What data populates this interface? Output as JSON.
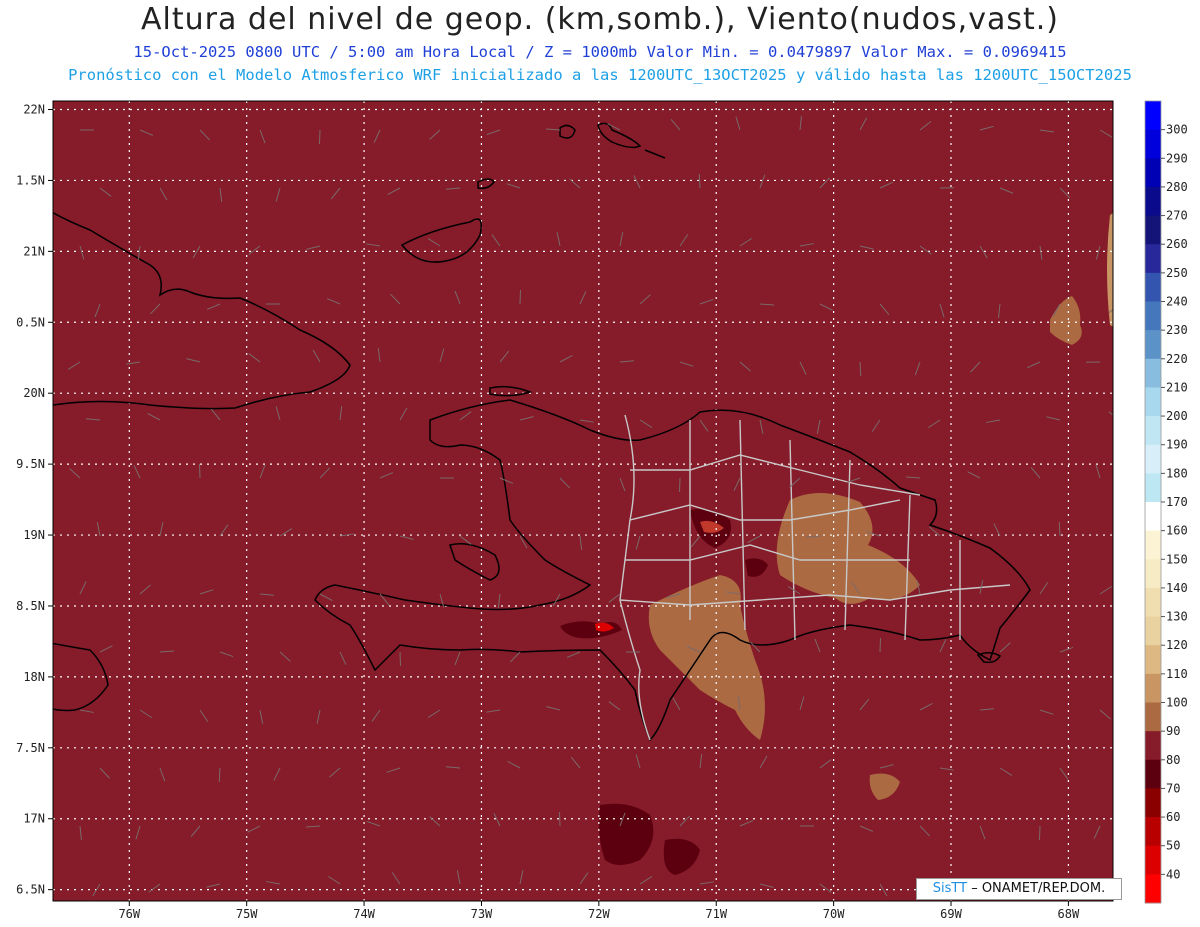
{
  "header": {
    "title": "Altura del nivel de geop. (km,somb.), Viento(nudos,vast.)",
    "subtitle_1": "15-Oct-2025  0800 UTC / 5:00 am Hora Local / Z = 1000mb Valor Min. = 0.0479897  Valor Max. = 0.0969415",
    "subtitle_2": "Pronóstico con el Modelo Atmosferico WRF inicializado a las 1200UTC_13OCT2025 y válido hasta las  1200UTC_15OCT2025"
  },
  "map": {
    "lon_range": [
      -76.65,
      -67.62
    ],
    "lat_range": [
      16.42,
      22.06
    ],
    "lon_ticks": [
      "76W",
      "75W",
      "74W",
      "73W",
      "72W",
      "71W",
      "70W",
      "69W",
      "68W"
    ],
    "lat_ticks": [
      "22N",
      "1.5N",
      "21N",
      "0.5N",
      "20N",
      "9.5N",
      "19N",
      "8.5N",
      "18N",
      "7.5N",
      "17N",
      "6.5N"
    ],
    "background_color": "#861b29",
    "grid": "dotted white"
  },
  "colorbar": {
    "labels": [
      "300",
      "290",
      "280",
      "270",
      "260",
      "250",
      "240",
      "230",
      "220",
      "210",
      "200",
      "190",
      "180",
      "170",
      "160",
      "150",
      "140",
      "130",
      "120",
      "110",
      "100",
      "90",
      "80",
      "70",
      "60",
      "50",
      "40"
    ],
    "colors": [
      "#0000ff",
      "#0000dc",
      "#0000b4",
      "#0a0a8c",
      "#141478",
      "#28289a",
      "#3355b0",
      "#4477bb",
      "#5b93c8",
      "#88bde0",
      "#a8d8ee",
      "#c0e6f3",
      "#d8effa",
      "#bde8f3",
      "#ffffff",
      "#fbf3d3",
      "#f6ebc5",
      "#f0deb0",
      "#ead2a0",
      "#ddb882",
      "#c99562",
      "#ac6a43",
      "#861b29",
      "#5c0010",
      "#8a0000",
      "#b80000",
      "#dd0000",
      "#ff0000"
    ]
  },
  "credit": {
    "brand": "SisTT",
    "text": " – ONAMET/REP.DOM."
  }
}
